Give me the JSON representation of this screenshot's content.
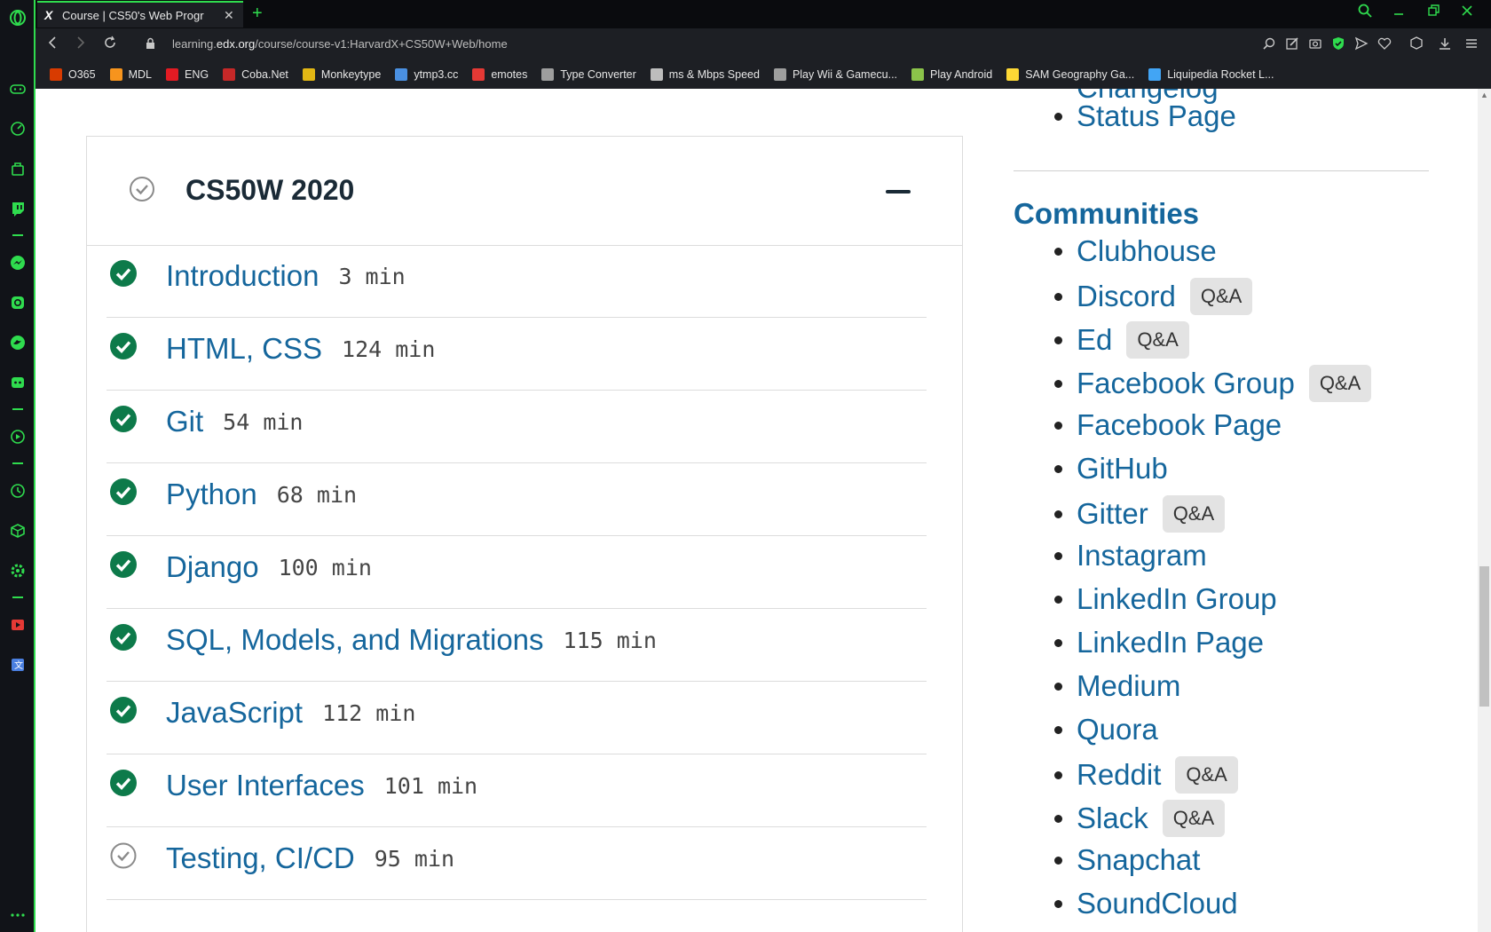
{
  "browser": {
    "tab_title": "Course | CS50's Web Progr",
    "url_prefix": "learning.",
    "url_domain": "edx.org",
    "url_path": "/course/course-v1:HarvardX+CS50W+Web/home",
    "bookmarks": [
      {
        "label": "O365",
        "color": "#d83b01"
      },
      {
        "label": "MDL",
        "color": "#f7941d"
      },
      {
        "label": "ENG",
        "color": "#e31b23"
      },
      {
        "label": "Coba.Net",
        "color": "#c62828"
      },
      {
        "label": "Monkeytype",
        "color": "#e2b714"
      },
      {
        "label": "ytmp3.cc",
        "color": "#4a90e2"
      },
      {
        "label": "emotes",
        "color": "#e53935"
      },
      {
        "label": "Type Converter",
        "color": "#9e9e9e"
      },
      {
        "label": "ms & Mbps Speed",
        "color": "#bdbdbd"
      },
      {
        "label": "Play Wii & Gamecu...",
        "color": "#9e9e9e"
      },
      {
        "label": "Play Android",
        "color": "#8bc34a"
      },
      {
        "label": "SAM Geography Ga...",
        "color": "#fdd835"
      },
      {
        "label": "Liquipedia Rocket L...",
        "color": "#42a5f5"
      }
    ]
  },
  "course": {
    "section_title": "CS50W 2020",
    "lessons": [
      {
        "name": "Introduction",
        "duration": "3 min",
        "done": true
      },
      {
        "name": "HTML, CSS",
        "duration": "124 min",
        "done": true
      },
      {
        "name": "Git",
        "duration": "54 min",
        "done": true
      },
      {
        "name": "Python",
        "duration": "68 min",
        "done": true
      },
      {
        "name": "Django",
        "duration": "100 min",
        "done": true
      },
      {
        "name": "SQL, Models, and Migrations",
        "duration": "115 min",
        "done": true
      },
      {
        "name": "JavaScript",
        "duration": "112 min",
        "done": true
      },
      {
        "name": "User Interfaces",
        "duration": "101 min",
        "done": true
      },
      {
        "name": "Testing, CI/CD",
        "duration": "95 min",
        "done": false
      }
    ]
  },
  "aside": {
    "partial_top": "Changelog",
    "status_page": "Status Page",
    "communities_heading": "Communities",
    "qa_label": "Q&A",
    "communities": [
      {
        "name": "Clubhouse",
        "qa": false
      },
      {
        "name": "Discord",
        "qa": true
      },
      {
        "name": "Ed",
        "qa": true
      },
      {
        "name": "Facebook Group",
        "qa": true
      },
      {
        "name": "Facebook Page",
        "qa": false
      },
      {
        "name": "GitHub",
        "qa": false
      },
      {
        "name": "Gitter",
        "qa": true
      },
      {
        "name": "Instagram",
        "qa": false
      },
      {
        "name": "LinkedIn Group",
        "qa": false
      },
      {
        "name": "LinkedIn Page",
        "qa": false
      },
      {
        "name": "Medium",
        "qa": false
      },
      {
        "name": "Quora",
        "qa": false
      },
      {
        "name": "Reddit",
        "qa": true
      },
      {
        "name": "Slack",
        "qa": true
      },
      {
        "name": "Snapchat",
        "qa": false
      },
      {
        "name": "SoundCloud",
        "qa": false
      }
    ]
  },
  "colors": {
    "accent": "#2fdc4e",
    "link": "#15669c",
    "done_check": "#0d7a4a",
    "todo_check": "#8a8a8a"
  }
}
